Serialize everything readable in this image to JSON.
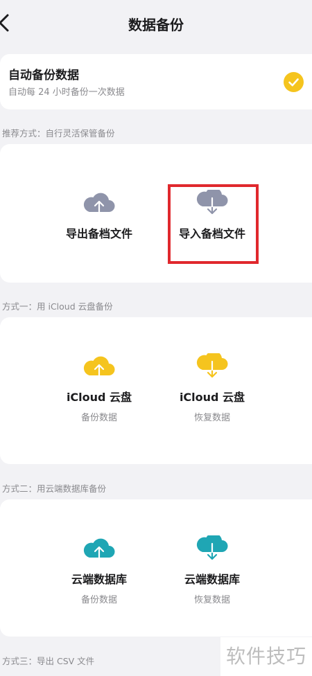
{
  "nav": {
    "title": "数据备份",
    "back_icon": "chevron-left-icon"
  },
  "auto_backup": {
    "title": "自动备份数据",
    "subtitle": "自动每 24 小时备份一次数据",
    "checked": true,
    "check_color": "#f5c41e"
  },
  "sections": [
    {
      "heading": "推荐方式：自行灵活保管备份",
      "options": [
        {
          "label": "导出备档文件",
          "sub": "",
          "icon": "cloud-upload-icon",
          "color": "#8f94aa"
        },
        {
          "label": "导入备档文件",
          "sub": "",
          "icon": "cloud-download-icon",
          "color": "#8f94aa",
          "highlighted": true
        }
      ]
    },
    {
      "heading": "方式一：用 iCloud 云盘备份",
      "options": [
        {
          "label": "iCloud 云盘",
          "sub": "备份数据",
          "icon": "cloud-upload-icon",
          "color": "#f5c41e"
        },
        {
          "label": "iCloud 云盘",
          "sub": "恢复数据",
          "icon": "cloud-download-icon",
          "color": "#f5c41e"
        }
      ]
    },
    {
      "heading": "方式二：用云端数据库备份",
      "options": [
        {
          "label": "云端数据库",
          "sub": "备份数据",
          "icon": "cloud-upload-icon",
          "color": "#1fa6b4"
        },
        {
          "label": "云端数据库",
          "sub": "恢复数据",
          "icon": "cloud-download-icon",
          "color": "#1fa6b4"
        }
      ]
    },
    {
      "heading": "方式三：导出 CSV 文件",
      "options": []
    }
  ],
  "highlight_color": "#e0282d",
  "watermark": "软件技巧"
}
